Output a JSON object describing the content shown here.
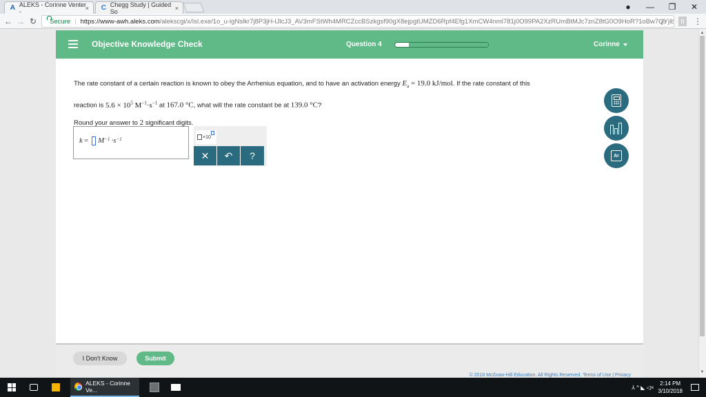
{
  "browser": {
    "tabs": [
      {
        "title": "ALEKS - Corinne Venter - ",
        "icon": "aleks-icon",
        "close": "×"
      },
      {
        "title": "Chegg Study | Guided So",
        "icon": "chegg-icon",
        "close": "×"
      }
    ],
    "window_controls": {
      "profile": "●",
      "minimize": "—",
      "restore": "❐",
      "close": "✕"
    },
    "nav": {
      "back": "←",
      "forward": "→",
      "reload": "↻"
    },
    "secure_label": "Secure",
    "url_host": "https://www-awh.aleks.com",
    "url_path": "/alekscgi/x/Isl.exe/1o_u-lgNslkr7j8P3jH-lJlcJ3_AV3mFStWh4MRCZccBSzkgsf90gX8ejpgtUMZD6Rpf4Efg1XmCW4nml781j0O99PA2XzRUmBtMJc7znZ8tG0O9HoR?1oBw7QYjlbav...",
    "star": "☆"
  },
  "header": {
    "title": "Objective Knowledge Check",
    "question_label": "Question 4",
    "progress_fraction": 0.15,
    "user": "Corinne"
  },
  "question": {
    "line1_pre": "The rate constant of a certain reaction is known to obey the Arrhenius equation, and to have an activation energy ",
    "ea_symbol": "E",
    "ea_sub": "a",
    "ea_value": " = 19.0  kJ/mol",
    "line1_post": ". If the rate constant of this",
    "line2_pre": "reaction is ",
    "k_mantissa": "5.6 × 10",
    "k_exp": "5",
    "k_unit_m": " M",
    "k_unit_m_exp": "−1",
    "k_unit_s": "·s",
    "k_unit_s_exp": "−1",
    "line2_mid": " at ",
    "t1": "167.0 °C",
    "line2_post": ", what will the rate constant be at ",
    "t2": "139.0 °C",
    "line2_end": "?",
    "round_note": "Round your answer to ",
    "round_digits": "2",
    "round_note_end": " significant digits."
  },
  "answer": {
    "var": "k",
    "equals": " = ",
    "unit_m": "M",
    "unit_m_exp": "−1",
    "unit_dot": "·s",
    "unit_s_exp": "−1"
  },
  "tools": {
    "x10_label": "×10",
    "clear": "✕",
    "undo": "↶",
    "help": "?",
    "periodic": "Ar"
  },
  "footer": {
    "dont_know": "I Don't Know",
    "submit": "Submit",
    "copyright": "© 2018 McGraw-Hill Education. All Rights Reserved.   Terms of Use   |   Privacy"
  },
  "taskbar": {
    "chrome_label": "ALEKS - Corinne Ve...",
    "time": "2:14 PM",
    "date": "3/10/2018",
    "tray_icons": "⅄ ^ ◣ ◁×"
  }
}
